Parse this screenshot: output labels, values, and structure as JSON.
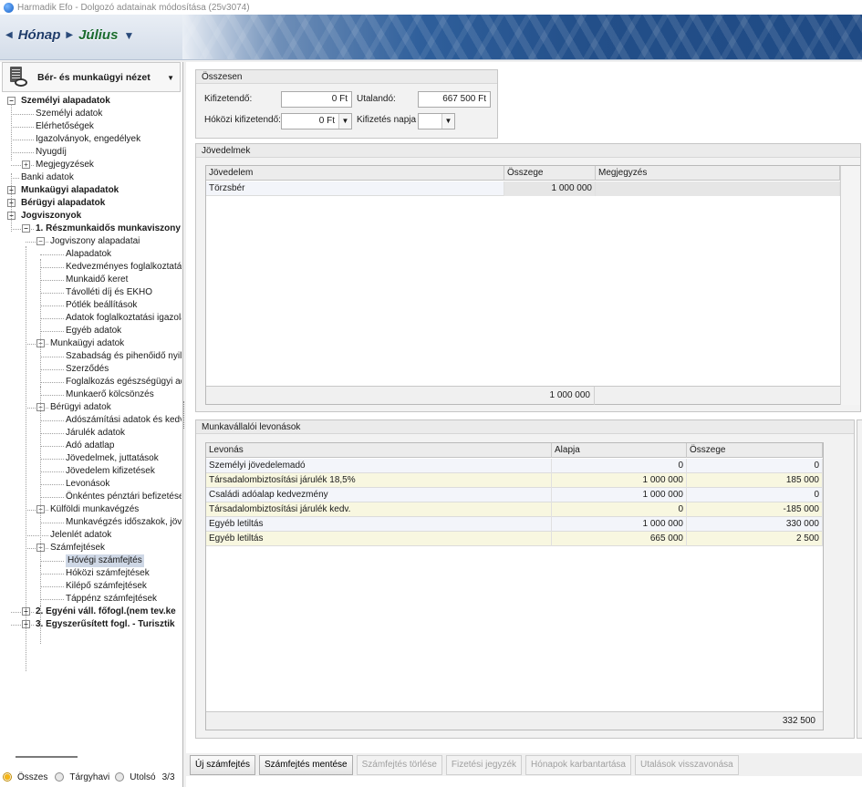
{
  "window": {
    "title": "Harmadik Efo - Dolgozó adatainak módosítása (25v3074)"
  },
  "nav": {
    "period_label": "Hónap",
    "month": "Július"
  },
  "sidebar": {
    "view_label": "Bér- és munkaügyi nézet",
    "tree": [
      "Személyi alapadatok",
      "Személyi adatok",
      "Elérhetőségek",
      "Igazolványok, engedélyek",
      "Nyugdíj",
      "Megjegyzések",
      "Banki adatok",
      "Munkaügyi alapadatok",
      "Bérügyi alapadatok",
      "Jogviszonyok",
      "1. Részmunkaidős munkaviszony",
      "Jogviszony alapadatai",
      "Alapadatok",
      "Kedvezményes foglalkoztatás",
      "Munkaidő keret",
      "Távolléti díj és EKHO",
      "Pótlék beállítások",
      "Adatok foglalkoztatási igazolás",
      "Egyéb adatok",
      "Munkaügyi adatok",
      "Szabadság és pihenőidő nyilvá",
      "Szerződés",
      "Foglalkozás egészségügyi ada",
      "Munkaerő kölcsönzés",
      "Bérügyi adatok",
      "Adószámítási adatok és kedve",
      "Járulék adatok",
      "Adó adatlap",
      "Jövedelmek, juttatások",
      "Jövedelem kifizetések",
      "Levonások",
      "Önkéntes pénztári befizetések",
      "Külföldi munkavégzés",
      "Munkavégzés időszakok, jövec",
      "Jelenlét adatok",
      "Számfejtések",
      "Hóvégi számfejtés",
      "Hóközi számfejtések",
      "Kilépő számfejtések",
      "Táppénz számfejtések",
      "2. Egyéni váll. főfogl.(nem tev.ke",
      "3. Egyszerűsített fogl. - Turisztik"
    ],
    "footer": {
      "all": "Összes",
      "monthly": "Tárgyhavi",
      "last": "Utolsó",
      "count": "3/3"
    }
  },
  "summary": {
    "title": "Összesen",
    "payable_label": "Kifizetendő:",
    "payable_value": "0 Ft",
    "transfer_label": "Utalandó:",
    "transfer_value": "667 500 Ft",
    "interim_label": "Hóközi kifizetendő:",
    "interim_value": "0 Ft",
    "payday_label": "Kifizetés napja",
    "payday_value": ""
  },
  "income": {
    "title": "Jövedelmek",
    "columns": [
      "Jövedelem",
      "Összege",
      "Megjegyzés"
    ],
    "rows": [
      {
        "name": "Törzsbér",
        "amount": "1 000 000",
        "note": ""
      }
    ],
    "total": "1 000 000"
  },
  "deductions": {
    "title": "Munkavállalói levonások",
    "columns": [
      "Levonás",
      "Alapja",
      "Összege"
    ],
    "rows": [
      {
        "name": "Személyi jövedelemadó",
        "base": "0",
        "amount": "0"
      },
      {
        "name": "Társadalombiztosítási járulék 18,5%",
        "base": "1 000 000",
        "amount": "185 000"
      },
      {
        "name": "Családi adóalap kedvezmény",
        "base": "1 000 000",
        "amount": "0"
      },
      {
        "name": "Társadalombiztosítási járulék kedv.",
        "base": "0",
        "amount": "-185 000"
      },
      {
        "name": "Egyéb letiltás",
        "base": "1 000 000",
        "amount": "330 000"
      },
      {
        "name": "Egyéb letiltás",
        "base": "665 000",
        "amount": "2 500"
      }
    ],
    "total": "332 500"
  },
  "actions": [
    {
      "label": "Új számfejtés",
      "enabled": true
    },
    {
      "label": "Számfejtés mentése",
      "enabled": true
    },
    {
      "label": "Számfejtés törlése",
      "enabled": false
    },
    {
      "label": "Fizetési jegyzék",
      "enabled": false
    },
    {
      "label": "Hónapok karbantartása",
      "enabled": false
    },
    {
      "label": "Utalások visszavonása",
      "enabled": false
    }
  ]
}
